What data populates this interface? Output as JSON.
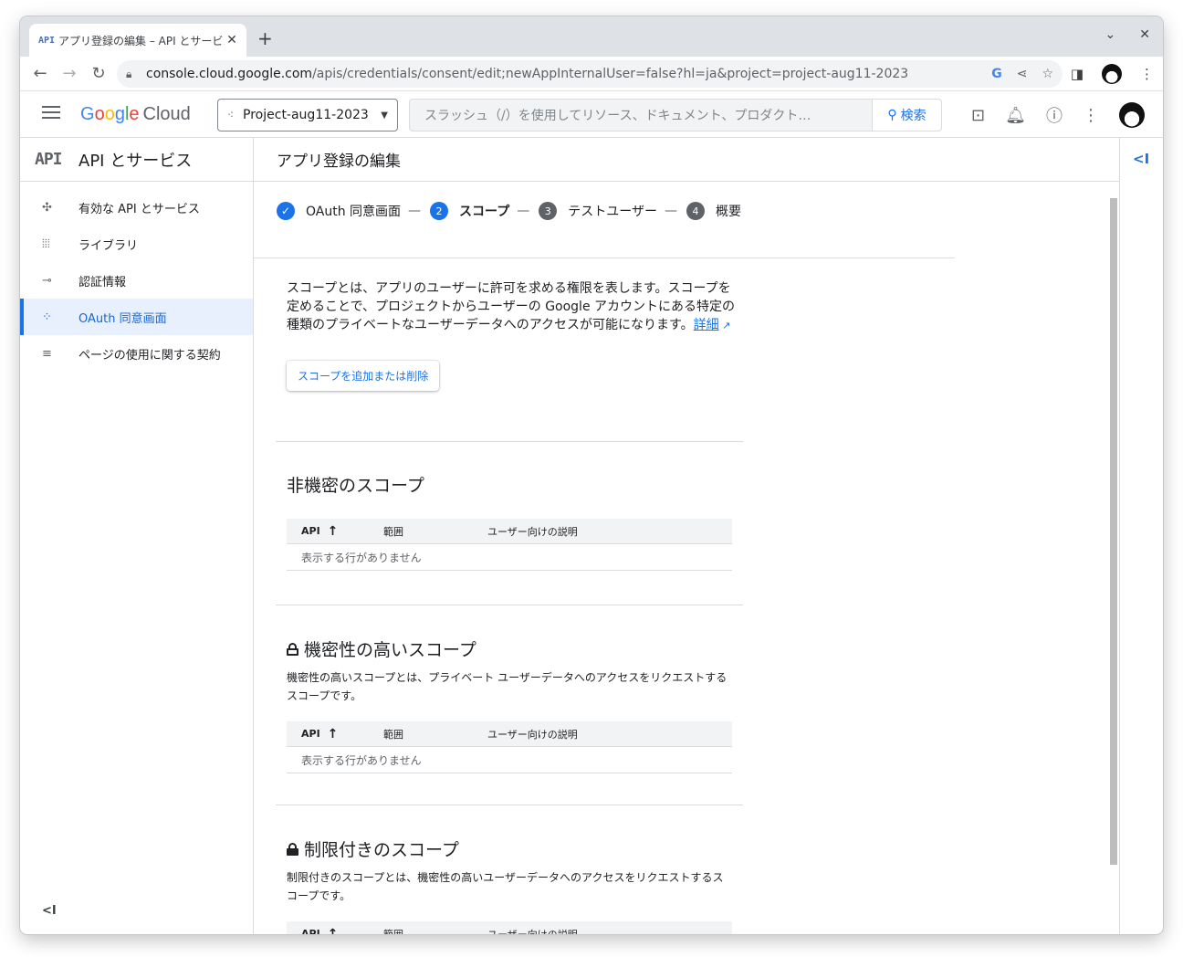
{
  "browser": {
    "tab_favicon": "API",
    "tab_title": "アプリ登録の編集 – API とサービス",
    "tab_close": "✕",
    "new_tab": "+",
    "url_host": "console.cloud.google.com",
    "url_path": "/apis/credentials/consent/edit;newAppInternalUser=false?hl=ja&project=project-aug11-2023",
    "back_icon": "←",
    "forward_icon": "→",
    "reload_icon": "↻",
    "chevron_icon": "⌄",
    "window_close_icon": "✕"
  },
  "header": {
    "project_name": "Project-aug11-2023",
    "search_placeholder": "スラッシュ（/）を使用してリソース、ドキュメント、プロダクト…",
    "search_button": "検索",
    "logo_cloud": "Cloud"
  },
  "sidebar": {
    "logo": "API",
    "title": "API とサービス",
    "items": [
      {
        "icon": "✣",
        "label": "有効な API とサービス",
        "active": false
      },
      {
        "icon": "⦙⦙⦙",
        "label": "ライブラリ",
        "active": false
      },
      {
        "icon": "⊸",
        "label": "認証情報",
        "active": false
      },
      {
        "icon": "⁘",
        "label": "OAuth 同意画面",
        "active": true
      },
      {
        "icon": "≡",
        "label": "ページの使用に関する契約",
        "active": false
      }
    ],
    "collapse": "<I"
  },
  "main": {
    "title": "アプリ登録の編集",
    "steps": [
      {
        "num": "✓",
        "label": "OAuth 同意画面",
        "state": "done"
      },
      {
        "num": "2",
        "label": "スコープ",
        "state": "current"
      },
      {
        "num": "3",
        "label": "テストユーザー",
        "state": "todo"
      },
      {
        "num": "4",
        "label": "概要",
        "state": "todo"
      }
    ],
    "step_separator": "—",
    "description": "スコープとは、アプリのユーザーに許可を求める権限を表します。スコープを定めることで、プロジェクトからユーザーの Google アカウントにある特定の種類のプライベートなユーザーデータへのアクセスが可能になります。",
    "learn_more": "詳細",
    "add_button": "スコープを追加または削除",
    "table_headers": {
      "api": "API",
      "range": "範囲",
      "desc": "ユーザー向けの説明"
    },
    "sort_arrow": "↑",
    "empty_text": "表示する行がありません",
    "sections": {
      "nonsensitive": {
        "title": "非機密のスコープ"
      },
      "sensitive": {
        "title": "機密性の高いスコープ",
        "desc": "機密性の高いスコープとは、プライベート ユーザーデータへのアクセスをリクエストするスコープです。"
      },
      "restricted": {
        "title": "制限付きのスコープ",
        "desc": "制限付きのスコープとは、機密性の高いユーザーデータへのアクセスをリクエストするスコープです。"
      }
    }
  },
  "rail": {
    "toggle": "<I"
  }
}
